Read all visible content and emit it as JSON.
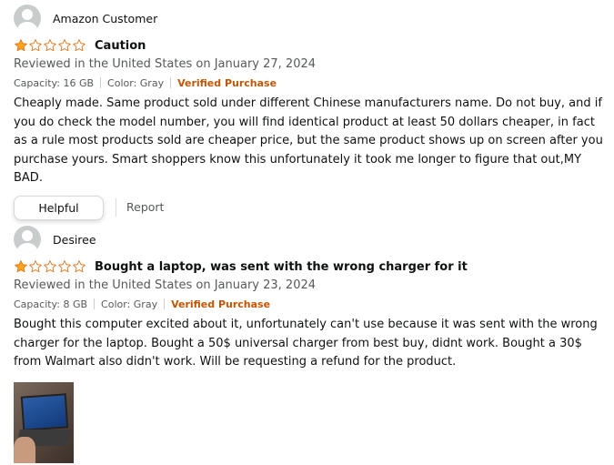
{
  "reviews": [
    {
      "reviewer": "Amazon Customer",
      "rating": 1,
      "max_rating": 5,
      "title": "Caution",
      "date": "Reviewed in the United States on January 27, 2024",
      "capacity": "Capacity: 16 GB",
      "color": "Color: Gray",
      "verified": "Verified Purchase",
      "body": "Cheaply made. Same product sold under different Chinese manufacturers name. Do not buy, and if you do check the model number, you will find identical product at least 50 dollars cheaper, in fact as a rule most products sold are cheaper price, but the same product shows up on screen after you purchase yours. Smart shoppers know this unfortunately it took me longer to figure that out,MY BAD.",
      "helpful_label": "Helpful",
      "report_label": "Report"
    },
    {
      "reviewer": "Desiree",
      "rating": 1,
      "max_rating": 5,
      "title": "Bought a laptop, was sent with the wrong charger for it",
      "date": "Reviewed in the United States on January 23, 2024",
      "capacity": "Capacity: 8 GB",
      "color": "Color: Gray",
      "verified": "Verified Purchase",
      "body": "Bought this computer excited about it, unfortunately can't use because it was sent with the wrong charger for the laptop. Bought a 50$ universal charger from best buy, didnt work. Bought a 30$ from Walmart also didn't work. Will be requesting a refund for the product."
    }
  ],
  "colors": {
    "star_fill": "#FFA41C",
    "star_outline": "#DE7921",
    "verified": "#C45500"
  }
}
